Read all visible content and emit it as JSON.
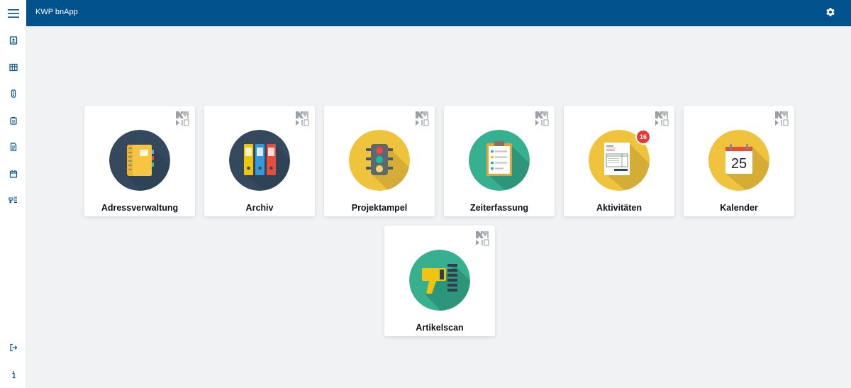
{
  "app": {
    "title": "KWP bnApp"
  },
  "colors": {
    "header": "#02528e",
    "dark_circle": "#34495e",
    "yellow_circle": "#f0c33c",
    "green_circle": "#37b08f",
    "badge": "#e53935"
  },
  "header": {
    "menu_icon": "hamburger-menu-icon",
    "settings_icon": "gear-icon"
  },
  "sidebar": {
    "items": [
      {
        "icon": "address-book-icon"
      },
      {
        "icon": "archive-grid-icon"
      },
      {
        "icon": "traffic-light-icon"
      },
      {
        "icon": "clipboard-icon"
      },
      {
        "icon": "document-icon"
      },
      {
        "icon": "calendar-icon"
      },
      {
        "icon": "barcode-scanner-icon"
      }
    ],
    "bottom_items": [
      {
        "icon": "logout-icon"
      },
      {
        "icon": "info-icon"
      }
    ]
  },
  "tiles": [
    {
      "label": "Adressverwaltung",
      "icon": "address-book-icon"
    },
    {
      "label": "Archiv",
      "icon": "binders-icon"
    },
    {
      "label": "Projektampel",
      "icon": "traffic-light-icon"
    },
    {
      "label": "Zeiterfassung",
      "icon": "clipboard-icon"
    },
    {
      "label": "Aktivitäten",
      "icon": "invoice-icon",
      "badge": "16"
    },
    {
      "label": "Kalender",
      "icon": "calendar-icon",
      "day": "25"
    },
    {
      "label": "Artikelscan",
      "icon": "barcode-scanner-icon"
    }
  ]
}
